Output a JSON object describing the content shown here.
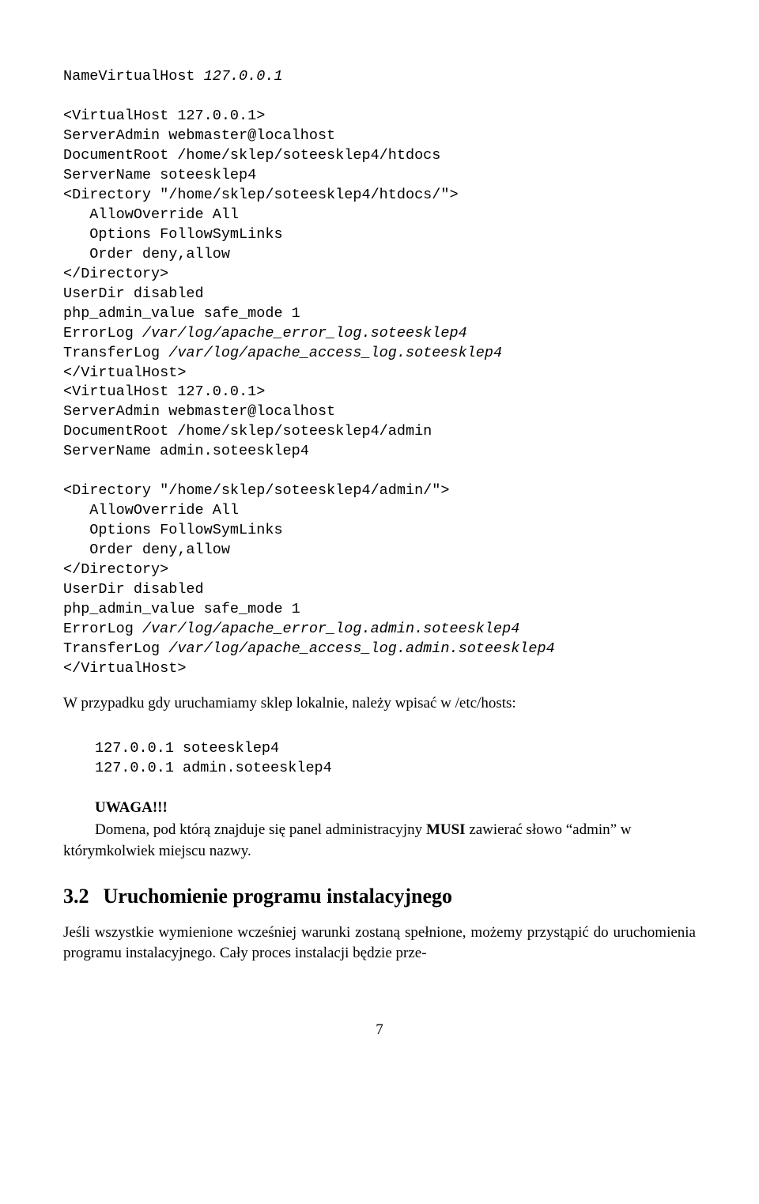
{
  "code1": {
    "l0": "NameVirtualHost ",
    "l0i": "127.0.0.1",
    "blank1": "",
    "l1": "<VirtualHost 127.0.0.1>",
    "l2": "ServerAdmin webmaster@localhost",
    "l3": "DocumentRoot /home/sklep/soteesklep4/htdocs",
    "l4": "ServerName soteesklep4",
    "l5": "<Directory \"/home/sklep/soteesklep4/htdocs/\">",
    "l6": "   AllowOverride All",
    "l7": "   Options FollowSymLinks",
    "l8": "   Order deny,allow",
    "l9": "</Directory>",
    "l10": "UserDir disabled",
    "l11": "php_admin_value safe_mode 1",
    "l12a": "ErrorLog ",
    "l12b": "/var/log/apache_error_log.soteesklep4",
    "l13a": "TransferLog ",
    "l13b": "/var/log/apache_access_log.soteesklep4",
    "l14": "</VirtualHost>",
    "l15": "<VirtualHost 127.0.0.1>",
    "l16": "ServerAdmin webmaster@localhost",
    "l17": "DocumentRoot /home/sklep/soteesklep4/admin",
    "l18": "ServerName admin.soteesklep4",
    "blank2": "",
    "l19": "<Directory \"/home/sklep/soteesklep4/admin/\">",
    "l20": "   AllowOverride All",
    "l21": "   Options FollowSymLinks",
    "l22": "   Order deny,allow",
    "l23": "</Directory>",
    "l24": "UserDir disabled",
    "l25": "php_admin_value safe_mode 1",
    "l26a": "ErrorLog ",
    "l26b": "/var/log/apache_error_log.admin.soteesklep4",
    "l27a": "TransferLog ",
    "l27b": "/var/log/apache_access_log.admin.soteesklep4",
    "l28": "</VirtualHost>"
  },
  "para1": "W przypadku gdy uruchamiamy sklep lokalnie, należy wpisać w /etc/hosts:",
  "hosts": {
    "l0": "127.0.0.1 soteesklep4",
    "l1": "127.0.0.1 admin.soteesklep4"
  },
  "uwaga": {
    "label": "UWAGA!!!",
    "text_a": "Domena, pod którą znajduje się panel administracyjny ",
    "text_bold": "MUSI",
    "text_b": " zawierać słowo “admin” w którymkolwiek miejscu nazwy."
  },
  "section": {
    "num": "3.2",
    "title": "Uruchomienie programu instalacyjnego"
  },
  "para2": "Jeśli wszystkie wymienione wcześniej warunki zostaną spełnione, możemy przystąpić do uruchomienia programu instalacyjnego. Cały proces instalacji będzie prze-",
  "pagenum": "7"
}
